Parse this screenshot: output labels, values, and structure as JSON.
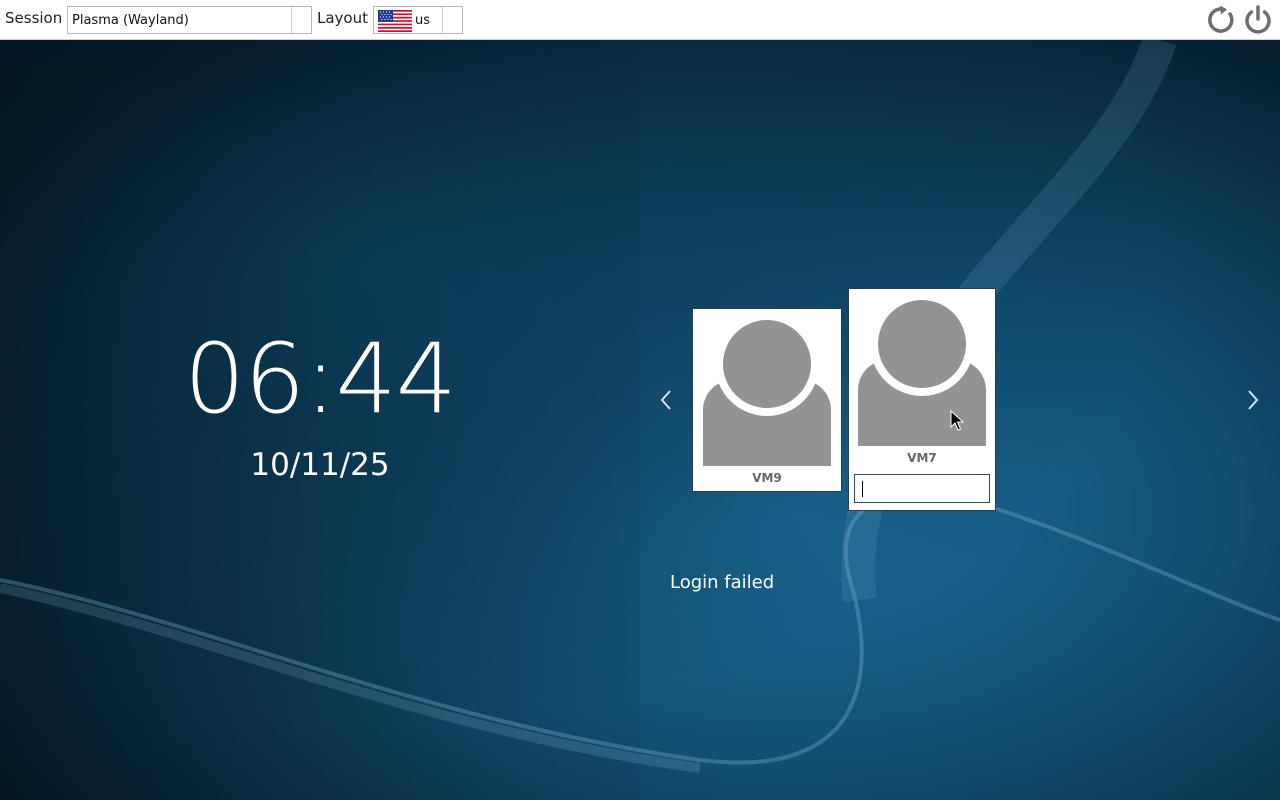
{
  "topbar": {
    "session_label": "Session",
    "session_value": "Plasma (Wayland)",
    "layout_label": "Layout",
    "layout_value": "us",
    "layout_flag_icon": "us-flag-icon",
    "restart_icon": "restart-icon",
    "power_icon": "power-icon"
  },
  "clock": {
    "time": "06:44",
    "date": "10/11/25"
  },
  "users": [
    {
      "name": "VM9",
      "avatar_icon": "user-avatar-icon"
    },
    {
      "name": "VM7",
      "avatar_icon": "user-avatar-icon",
      "selected": true
    }
  ],
  "password": {
    "value": ""
  },
  "status": {
    "message": "Login failed"
  },
  "colors": {
    "background_dark": "#062236",
    "background_accent": "#1a6a96",
    "avatar_gray": "#939393",
    "topbar": "#ffffff"
  }
}
